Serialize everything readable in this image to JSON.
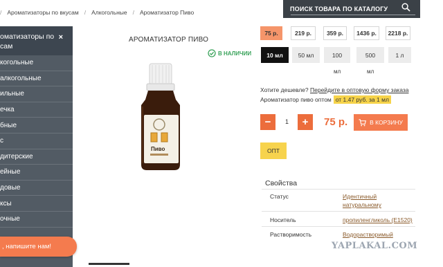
{
  "breadcrumb": [
    "Ароматизаторы по вкусам",
    "Алкогольные",
    "Ароматизатор Пиво"
  ],
  "search": {
    "label": "ПОИСК ТОВАРА ПО КАТАЛОГУ",
    "icon": "search-icon"
  },
  "sidebar": {
    "header": [
      "оматизаторы по",
      "сам"
    ],
    "close": "×",
    "items": [
      "когольные",
      "алкогольные",
      "ильные",
      "ечка",
      "бные",
      "с",
      "дитерские",
      "ейные",
      "довые",
      "ксы",
      "очные",
      ""
    ]
  },
  "chat": {
    "label": ", напишите нам!"
  },
  "product": {
    "title": "АРОМАТИЗАТОР ПИВО",
    "stock": "В НАЛИЧИИ",
    "stock_color": "#3aa35b",
    "label_text": "Пиво"
  },
  "prices": [
    {
      "price": "75 р.",
      "active": true
    },
    {
      "price": "219 р.",
      "active": false
    },
    {
      "price": "359 р.",
      "active": false
    },
    {
      "price": "1436 р.",
      "active": false
    },
    {
      "price": "2218 р.",
      "active": false
    }
  ],
  "volumes": [
    {
      "label": "10 мл",
      "active": true
    },
    {
      "label": "50 мл",
      "active": false
    },
    {
      "label": "100",
      "unit": "мл",
      "active": false
    },
    {
      "label": "500",
      "unit": "мл",
      "active": false
    },
    {
      "label": "1 л",
      "active": false
    }
  ],
  "wholesale": {
    "question": "Хотите дешевле?",
    "link": "Перейдите в оптовую форму заказа",
    "prefix": "Ароматизатор пиво оптом",
    "highlight": "от 1.47 руб. за 1 мл"
  },
  "cart": {
    "minus": "−",
    "quantity": "1",
    "plus": "+",
    "price": "75 р.",
    "button": "В КОРЗИНУ",
    "opt": "ОПТ"
  },
  "properties": {
    "title": "Свойства",
    "rows": [
      {
        "label": "Статус",
        "value": [
          "Идентичный",
          "натуральному"
        ]
      },
      {
        "label": "Носитель",
        "value": [
          "пропиленгликоль (E1520)"
        ]
      },
      {
        "label": "Растворимость",
        "value": [
          "Водорастворимый"
        ]
      }
    ]
  },
  "watermark": "YAPLAKAL.COM",
  "colors": {
    "accent": "#f47b4e",
    "sidebar": "#525b64",
    "highlight": "#f6d34a"
  }
}
